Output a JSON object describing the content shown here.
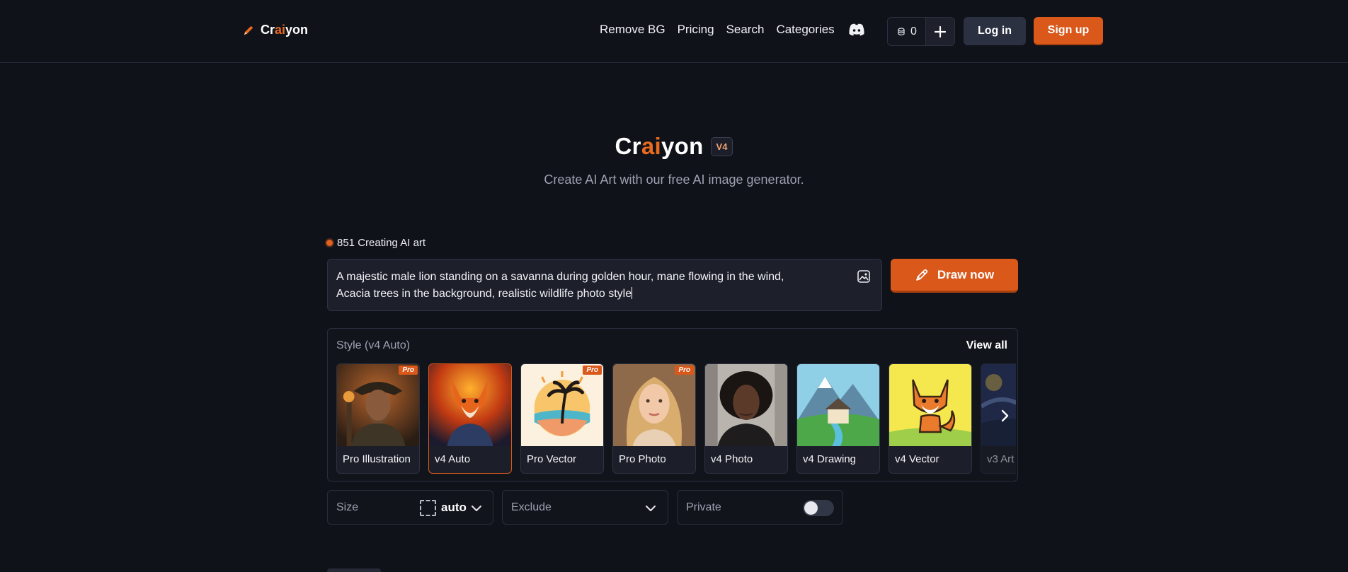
{
  "header": {
    "logo": {
      "pre": "Cr",
      "mid": "ai",
      "post": "yon"
    },
    "nav": [
      "Remove BG",
      "Pricing",
      "Search",
      "Categories"
    ],
    "credits": "0",
    "login_label": "Log in",
    "signup_label": "Sign up"
  },
  "hero": {
    "brand_pre": "Cr",
    "brand_mid": "ai",
    "brand_post": "yon",
    "version_badge": "V4",
    "subtitle": "Create AI Art with our free AI image generator."
  },
  "status": "851 Creating AI art",
  "prompt": {
    "line1": "A majestic male lion standing on a savanna during golden hour, mane flowing in the wind,",
    "line2": "Acacia trees in the background, realistic wildlife photo style"
  },
  "draw_label": "Draw now",
  "styles": {
    "label": "Style (v4 Auto)",
    "view_all": "View all",
    "pro_tag": "Pro",
    "cards": [
      {
        "label": "Pro Illustration",
        "pro": true
      },
      {
        "label": "v4 Auto",
        "pro": false,
        "selected": true
      },
      {
        "label": "Pro Vector",
        "pro": true
      },
      {
        "label": "Pro Photo",
        "pro": true
      },
      {
        "label": "v4 Photo",
        "pro": false
      },
      {
        "label": "v4 Drawing",
        "pro": false
      },
      {
        "label": "v4 Vector",
        "pro": false
      },
      {
        "label": "v3 Art",
        "pro": false
      }
    ]
  },
  "controls": {
    "size_label": "Size",
    "size_value": "auto",
    "exclude_label": "Exclude",
    "private_label": "Private",
    "private_on": false
  },
  "colors": {
    "accent": "#d9581a",
    "background": "#10121a",
    "panel": "#1d202b"
  }
}
